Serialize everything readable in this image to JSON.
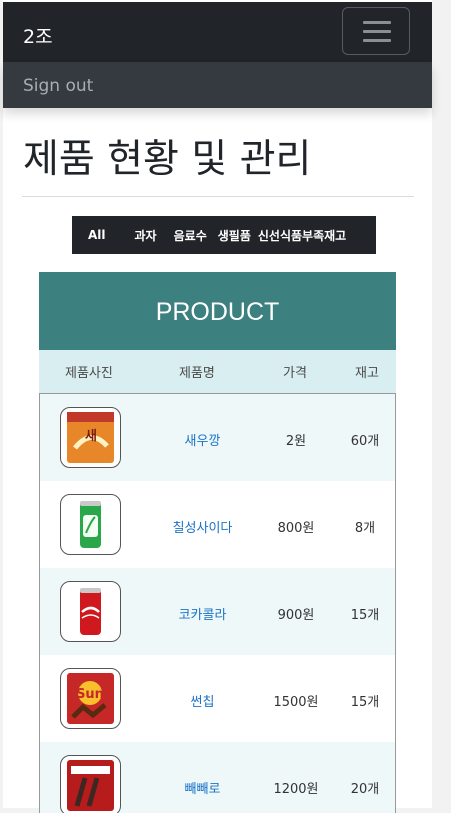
{
  "navbar": {
    "brand": "2조",
    "menu_icon": "hamburger-icon"
  },
  "menu": {
    "signout": "Sign out"
  },
  "page_title": "제품 현황 및 관리",
  "categories": [
    "All",
    "과자",
    "음료수",
    "생필품",
    "신선식품",
    "부족재고"
  ],
  "product_header": "PRODUCT",
  "columns": {
    "image": "제품사진",
    "name": "제품명",
    "price": "가격",
    "stock": "재고"
  },
  "products": [
    {
      "name": "새우깡",
      "price": "2원",
      "stock": "60개",
      "image_icon": "shrimp-snack-package-icon"
    },
    {
      "name": "칠성사이다",
      "price": "800원",
      "stock": "8개",
      "image_icon": "green-soda-can-icon"
    },
    {
      "name": "코카콜라",
      "price": "900원",
      "stock": "15개",
      "image_icon": "red-cola-can-icon"
    },
    {
      "name": "썬칩",
      "price": "1500원",
      "stock": "15개",
      "image_icon": "sun-chips-package-icon"
    },
    {
      "name": "빼빼로",
      "price": "1200원",
      "stock": "20개",
      "image_icon": "pepero-box-icon"
    }
  ],
  "colors": {
    "navbar": "#212529",
    "dropdown": "#343a40",
    "header": "#3d8080",
    "column_header": "#d8eef0",
    "link": "#1a73c8"
  }
}
